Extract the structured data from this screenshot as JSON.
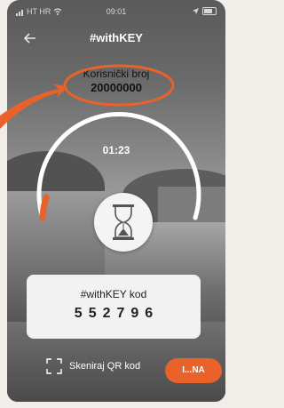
{
  "status_bar": {
    "carrier": "HT HR",
    "time": "09:01"
  },
  "header": {
    "title": "#withKEY"
  },
  "user": {
    "label": "Korisnički broj",
    "number": "20000000"
  },
  "timer": {
    "value": "01:23",
    "progress": 0.15
  },
  "code_card": {
    "label": "#withKEY kod",
    "code": "552796"
  },
  "bottom": {
    "scan_label": "Skeniraj QR kod",
    "action_label": "I...NA"
  },
  "colors": {
    "accent": "#e9622a",
    "card": "#f2f2f2"
  },
  "icons": [
    "back-arrow-icon",
    "hourglass-icon",
    "qr-scan-icon",
    "wifi-icon",
    "battery-icon"
  ]
}
